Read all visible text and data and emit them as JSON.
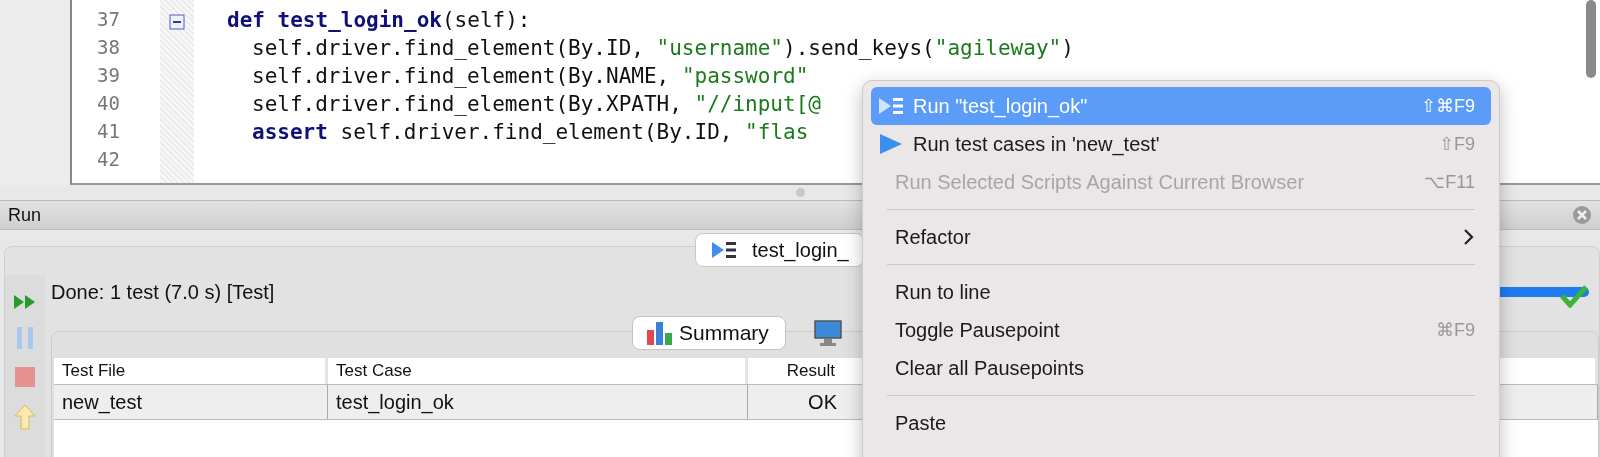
{
  "editor": {
    "lines": [
      {
        "number": "37",
        "fold": true,
        "tokens": [
          {
            "kind": "keyword",
            "text": "def"
          },
          {
            "kind": "function",
            "text": " test_login_ok"
          },
          {
            "kind": "plain",
            "text": "(self):"
          }
        ]
      },
      {
        "number": "38",
        "fold": false,
        "tokens": [
          {
            "kind": "plain",
            "text": "self.driver.find_element(By.ID, "
          },
          {
            "kind": "string",
            "text": "\"username\""
          },
          {
            "kind": "plain",
            "text": ").send_keys("
          },
          {
            "kind": "string",
            "text": "\"agileway\""
          },
          {
            "kind": "plain",
            "text": ")"
          }
        ]
      },
      {
        "number": "39",
        "fold": false,
        "tokens": [
          {
            "kind": "plain",
            "text": "self.driver.find_element(By.NAME, "
          },
          {
            "kind": "string",
            "text": "\"password\""
          }
        ]
      },
      {
        "number": "40",
        "fold": false,
        "tokens": [
          {
            "kind": "plain",
            "text": "self.driver.find_element(By.XPATH, "
          },
          {
            "kind": "string",
            "text": "\"//input[@"
          }
        ]
      },
      {
        "number": "41",
        "fold": false,
        "tokens": [
          {
            "kind": "keyword",
            "text": "assert"
          },
          {
            "kind": "plain",
            "text": " self.driver.find_element(By.ID, "
          },
          {
            "kind": "string",
            "text": "\"flas"
          }
        ]
      },
      {
        "number": "42",
        "fold": false
      }
    ]
  },
  "run_panel": {
    "title": "Run",
    "tab": {
      "label": "test_login_"
    },
    "status": "Done: 1 test (7.0 s) [Test]",
    "progress": {
      "level": 1
    },
    "result_tabs": [
      {
        "label": "Summary",
        "selected": true
      },
      {
        "selected": false
      }
    ],
    "table": {
      "columns": [
        "Test File",
        "Test Case",
        "Result"
      ],
      "rows": [
        [
          "new_test",
          "test_login_ok",
          "OK"
        ]
      ]
    }
  },
  "context_menu": [
    {
      "kind": "item",
      "label": "Run \"test_login_ok\"",
      "shortcut": "⇧⌘F9",
      "selected": true,
      "disabled": false
    },
    {
      "kind": "item",
      "label": "Run test cases in 'new_test'",
      "shortcut": "⇧F9",
      "selected": false,
      "disabled": false
    },
    {
      "kind": "item",
      "label": "Run Selected Scripts Against Current Browser",
      "shortcut": "⌥F11",
      "selected": false,
      "disabled": true
    },
    {
      "kind": "separator"
    },
    {
      "kind": "submenu",
      "label": "Refactor",
      "selected": false,
      "disabled": false
    },
    {
      "kind": "separator"
    },
    {
      "kind": "item",
      "label": "Run to line",
      "selected": false,
      "disabled": false
    },
    {
      "kind": "item",
      "label": "Toggle Pausepoint",
      "shortcut": "⌘F9",
      "selected": false,
      "disabled": false
    },
    {
      "kind": "item",
      "label": "Clear all Pausepoints",
      "selected": false,
      "disabled": false
    },
    {
      "kind": "separator"
    },
    {
      "kind": "item",
      "label": "Paste",
      "selected": false,
      "disabled": false
    }
  ]
}
